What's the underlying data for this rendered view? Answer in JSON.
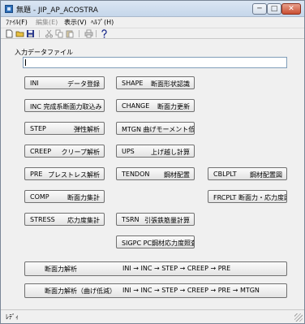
{
  "window": {
    "title": "無題 - JIP_AP_ACOSTRA"
  },
  "titlebar": {
    "min": "─",
    "max": "□",
    "close": "✕"
  },
  "menu": {
    "file": "ﾌｧｲﾙ(F)",
    "edit": "編集(E)",
    "view": "表示(V)",
    "help": "ﾍﾙﾌﾟ(H)"
  },
  "toolbar": {
    "icons": [
      "new-file-icon",
      "open-folder-icon",
      "save-icon",
      "cut-icon",
      "copy-icon",
      "paste-icon",
      "print-icon",
      "help-icon"
    ]
  },
  "form": {
    "input_label": "入力データファイル",
    "input_value": ""
  },
  "buttons": {
    "ini": {
      "code": "INI",
      "desc": "データ登録"
    },
    "inc": {
      "text": "INC 完成系断面力取込み"
    },
    "step": {
      "code": "STEP",
      "desc": "弾性解析"
    },
    "creep": {
      "code": "CREEP",
      "desc": "クリープ解析"
    },
    "pre": {
      "code": "PRE",
      "desc": "プレストレス解析"
    },
    "comp": {
      "code": "COMP",
      "desc": "断面力集計"
    },
    "stress": {
      "code": "STRESS",
      "desc": "応力度集計"
    },
    "shape": {
      "code": "SHAPE",
      "desc": "断面形状認識"
    },
    "change": {
      "code": "CHANGE",
      "desc": "断面力更新"
    },
    "mtgn": {
      "text": "MTGN 曲げモーメント低減"
    },
    "ups": {
      "code": "UPS",
      "desc": "上げ越し計算"
    },
    "tendon": {
      "code": "TENDON",
      "desc": "鋼材配置"
    },
    "tsrn": {
      "code": "TSRN",
      "desc": "引張鉄筋量計算"
    },
    "sigpc": {
      "text": "SIGPC PC鋼材応力度照査"
    },
    "cblplt": {
      "code": "CBLPLT",
      "desc": "鋼材配置図"
    },
    "frcplt": {
      "text": "FRCPLT 断面力・応力度図"
    },
    "flow1": {
      "left": "断面力解析",
      "right": "INI → INC → STEP → CREEP → PRE"
    },
    "flow2": {
      "left": "断面力解析（曲げ低減）",
      "right": "INI → INC → STEP → CREEP → PRE → MTGN"
    }
  },
  "status": {
    "text": "ﾚﾃﾞｨ"
  }
}
